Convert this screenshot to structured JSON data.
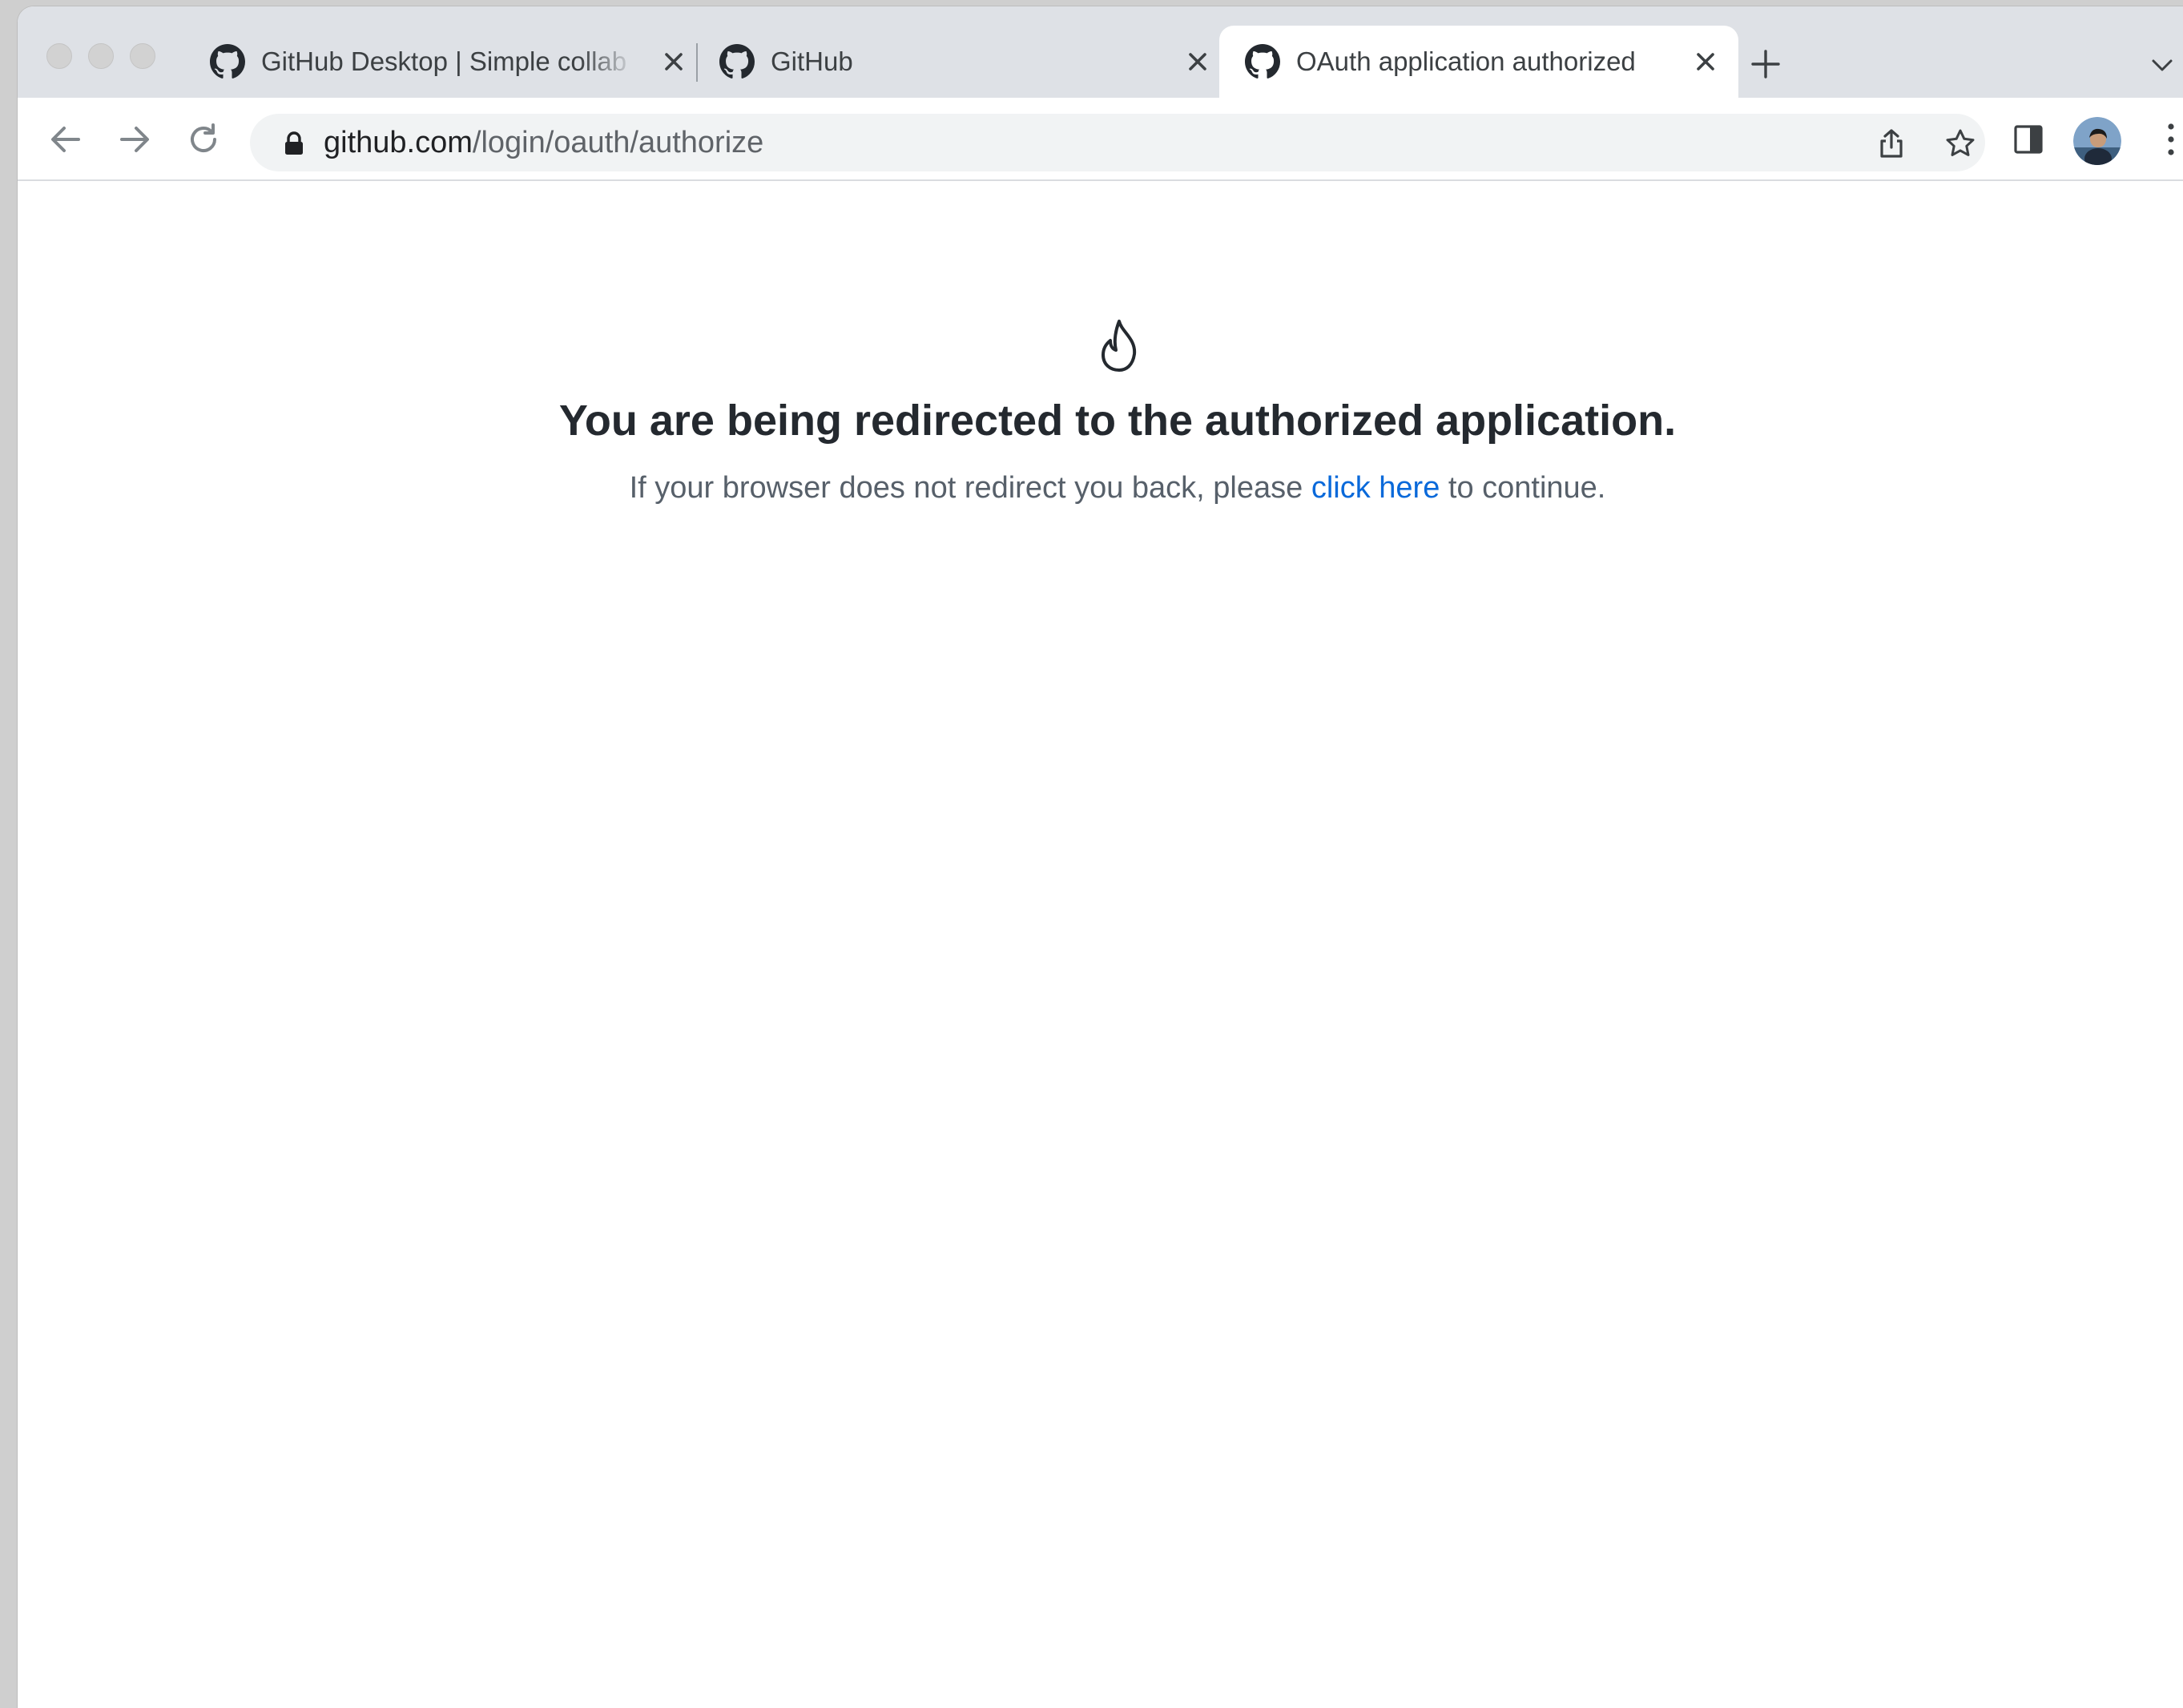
{
  "browser": {
    "tabs": [
      {
        "title": "GitHub Desktop | Simple collab",
        "active": false,
        "icon": "github-icon"
      },
      {
        "title": "GitHub",
        "active": false,
        "icon": "github-icon"
      },
      {
        "title": "OAuth application authorized",
        "active": true,
        "icon": "github-icon"
      }
    ],
    "address_bar": {
      "domain": "github.com",
      "path": "/login/oauth/authorize"
    }
  },
  "page": {
    "icon": "flame-icon",
    "heading": "You are being redirected to the authorized application.",
    "message_before": "If your browser does not redirect you back, please ",
    "link_text": "click here",
    "message_after": " to continue."
  },
  "colors": {
    "link": "#0969da",
    "heading": "#24292f",
    "text": "#57606a",
    "tabstrip": "#dee1e6"
  }
}
